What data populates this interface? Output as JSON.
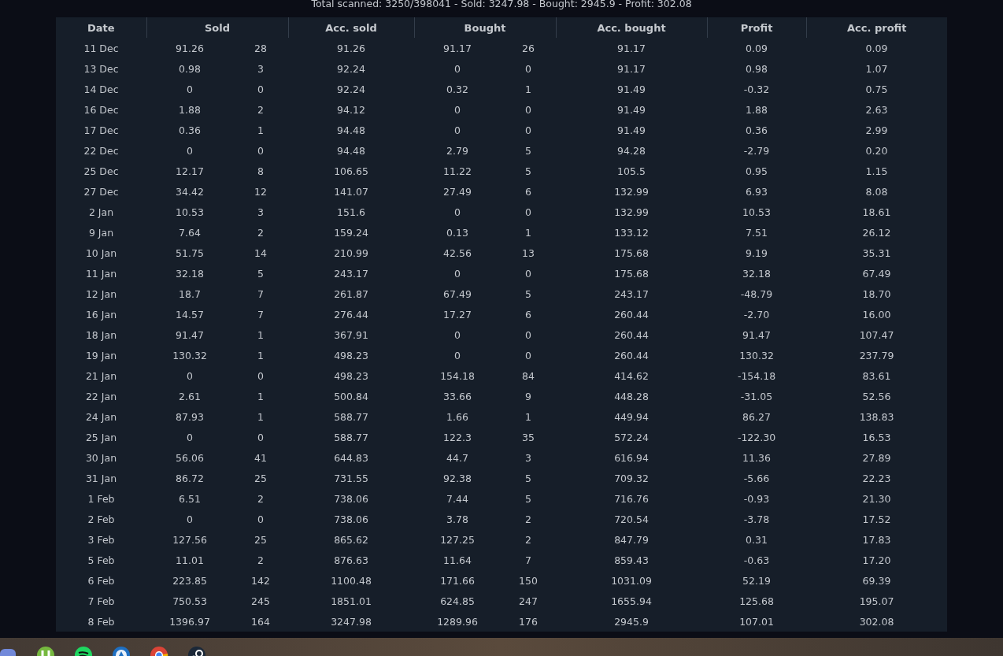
{
  "summary": "Total scanned: 3250/398041 - Sold: 3247.98 - Bought: 2945.9 - Profit: 302.08",
  "table": {
    "columns": [
      {
        "label": "Date",
        "kind": "single"
      },
      {
        "label": "Sold",
        "kind": "pair"
      },
      {
        "label": "Acc. sold",
        "kind": "single"
      },
      {
        "label": "Bought",
        "kind": "pair"
      },
      {
        "label": "Acc. bought",
        "kind": "single"
      },
      {
        "label": "Profit",
        "kind": "single"
      },
      {
        "label": "Acc. profit",
        "kind": "single"
      }
    ],
    "rows": [
      [
        "11 Dec",
        [
          "91.26",
          "28"
        ],
        "91.26",
        [
          "91.17",
          "26"
        ],
        "91.17",
        "0.09",
        "0.09"
      ],
      [
        "13 Dec",
        [
          "0.98",
          "3"
        ],
        "92.24",
        [
          "0",
          "0"
        ],
        "91.17",
        "0.98",
        "1.07"
      ],
      [
        "14 Dec",
        [
          "0",
          "0"
        ],
        "92.24",
        [
          "0.32",
          "1"
        ],
        "91.49",
        "-0.32",
        "0.75"
      ],
      [
        "16 Dec",
        [
          "1.88",
          "2"
        ],
        "94.12",
        [
          "0",
          "0"
        ],
        "91.49",
        "1.88",
        "2.63"
      ],
      [
        "17 Dec",
        [
          "0.36",
          "1"
        ],
        "94.48",
        [
          "0",
          "0"
        ],
        "91.49",
        "0.36",
        "2.99"
      ],
      [
        "22 Dec",
        [
          "0",
          "0"
        ],
        "94.48",
        [
          "2.79",
          "5"
        ],
        "94.28",
        "-2.79",
        "0.20"
      ],
      [
        "25 Dec",
        [
          "12.17",
          "8"
        ],
        "106.65",
        [
          "11.22",
          "5"
        ],
        "105.5",
        "0.95",
        "1.15"
      ],
      [
        "27 Dec",
        [
          "34.42",
          "12"
        ],
        "141.07",
        [
          "27.49",
          "6"
        ],
        "132.99",
        "6.93",
        "8.08"
      ],
      [
        "2 Jan",
        [
          "10.53",
          "3"
        ],
        "151.6",
        [
          "0",
          "0"
        ],
        "132.99",
        "10.53",
        "18.61"
      ],
      [
        "9 Jan",
        [
          "7.64",
          "2"
        ],
        "159.24",
        [
          "0.13",
          "1"
        ],
        "133.12",
        "7.51",
        "26.12"
      ],
      [
        "10 Jan",
        [
          "51.75",
          "14"
        ],
        "210.99",
        [
          "42.56",
          "13"
        ],
        "175.68",
        "9.19",
        "35.31"
      ],
      [
        "11 Jan",
        [
          "32.18",
          "5"
        ],
        "243.17",
        [
          "0",
          "0"
        ],
        "175.68",
        "32.18",
        "67.49"
      ],
      [
        "12 Jan",
        [
          "18.7",
          "7"
        ],
        "261.87",
        [
          "67.49",
          "5"
        ],
        "243.17",
        "-48.79",
        "18.70"
      ],
      [
        "16 Jan",
        [
          "14.57",
          "7"
        ],
        "276.44",
        [
          "17.27",
          "6"
        ],
        "260.44",
        "-2.70",
        "16.00"
      ],
      [
        "18 Jan",
        [
          "91.47",
          "1"
        ],
        "367.91",
        [
          "0",
          "0"
        ],
        "260.44",
        "91.47",
        "107.47"
      ],
      [
        "19 Jan",
        [
          "130.32",
          "1"
        ],
        "498.23",
        [
          "0",
          "0"
        ],
        "260.44",
        "130.32",
        "237.79"
      ],
      [
        "21 Jan",
        [
          "0",
          "0"
        ],
        "498.23",
        [
          "154.18",
          "84"
        ],
        "414.62",
        "-154.18",
        "83.61"
      ],
      [
        "22 Jan",
        [
          "2.61",
          "1"
        ],
        "500.84",
        [
          "33.66",
          "9"
        ],
        "448.28",
        "-31.05",
        "52.56"
      ],
      [
        "24 Jan",
        [
          "87.93",
          "1"
        ],
        "588.77",
        [
          "1.66",
          "1"
        ],
        "449.94",
        "86.27",
        "138.83"
      ],
      [
        "25 Jan",
        [
          "0",
          "0"
        ],
        "588.77",
        [
          "122.3",
          "35"
        ],
        "572.24",
        "-122.30",
        "16.53"
      ],
      [
        "30 Jan",
        [
          "56.06",
          "41"
        ],
        "644.83",
        [
          "44.7",
          "3"
        ],
        "616.94",
        "11.36",
        "27.89"
      ],
      [
        "31 Jan",
        [
          "86.72",
          "25"
        ],
        "731.55",
        [
          "92.38",
          "5"
        ],
        "709.32",
        "-5.66",
        "22.23"
      ],
      [
        "1 Feb",
        [
          "6.51",
          "2"
        ],
        "738.06",
        [
          "7.44",
          "5"
        ],
        "716.76",
        "-0.93",
        "21.30"
      ],
      [
        "2 Feb",
        [
          "0",
          "0"
        ],
        "738.06",
        [
          "3.78",
          "2"
        ],
        "720.54",
        "-3.78",
        "17.52"
      ],
      [
        "3 Feb",
        [
          "127.56",
          "25"
        ],
        "865.62",
        [
          "127.25",
          "2"
        ],
        "847.79",
        "0.31",
        "17.83"
      ],
      [
        "5 Feb",
        [
          "11.01",
          "2"
        ],
        "876.63",
        [
          "11.64",
          "7"
        ],
        "859.43",
        "-0.63",
        "17.20"
      ],
      [
        "6 Feb",
        [
          "223.85",
          "142"
        ],
        "1100.48",
        [
          "171.66",
          "150"
        ],
        "1031.09",
        "52.19",
        "69.39"
      ],
      [
        "7 Feb",
        [
          "750.53",
          "245"
        ],
        "1851.01",
        [
          "624.85",
          "247"
        ],
        "1655.94",
        "125.68",
        "195.07"
      ],
      [
        "8 Feb",
        [
          "1396.97",
          "164"
        ],
        "3247.98",
        [
          "1289.96",
          "176"
        ],
        "2945.9",
        "107.01",
        "302.08"
      ]
    ]
  }
}
